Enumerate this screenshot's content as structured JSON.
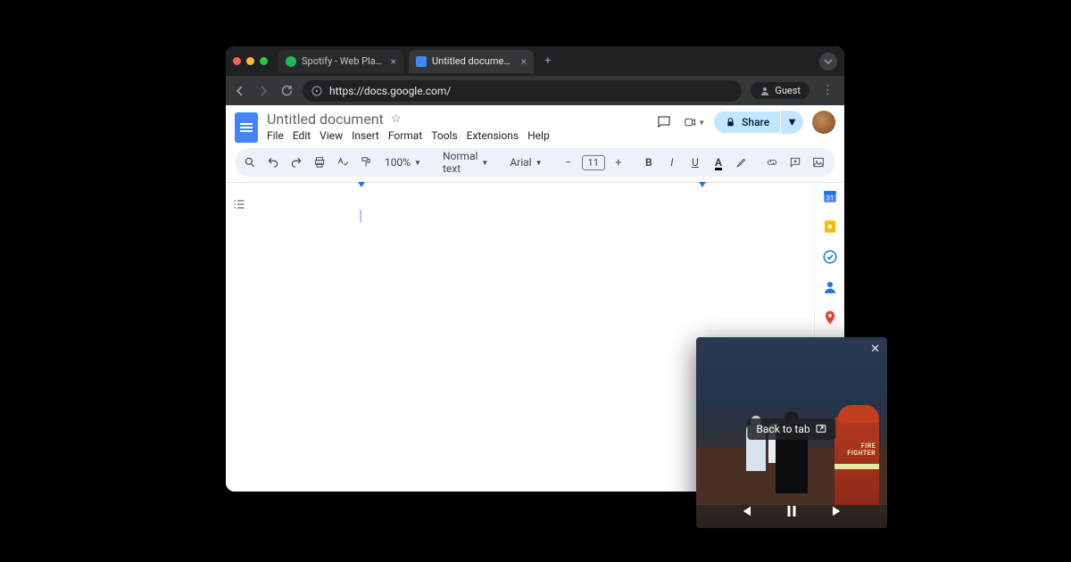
{
  "browser": {
    "tabs": [
      {
        "label": "Spotify - Web Player: Music f",
        "favicon_color": "#1db954",
        "active": false
      },
      {
        "label": "Untitled document - Google D",
        "favicon_color": "#4285f4",
        "active": true
      }
    ],
    "url": "https://docs.google.com/",
    "guest_label": "Guest"
  },
  "docs": {
    "title": "Untitled document",
    "menus": [
      "File",
      "Edit",
      "View",
      "Insert",
      "Format",
      "Tools",
      "Extensions",
      "Help"
    ],
    "share_label": "Share",
    "zoom": "100%",
    "style": "Normal text",
    "font": "Arial",
    "font_size": "11"
  },
  "pip": {
    "back_label": "Back to tab",
    "firefighter_text": "FIRE\nFIGHTER"
  }
}
